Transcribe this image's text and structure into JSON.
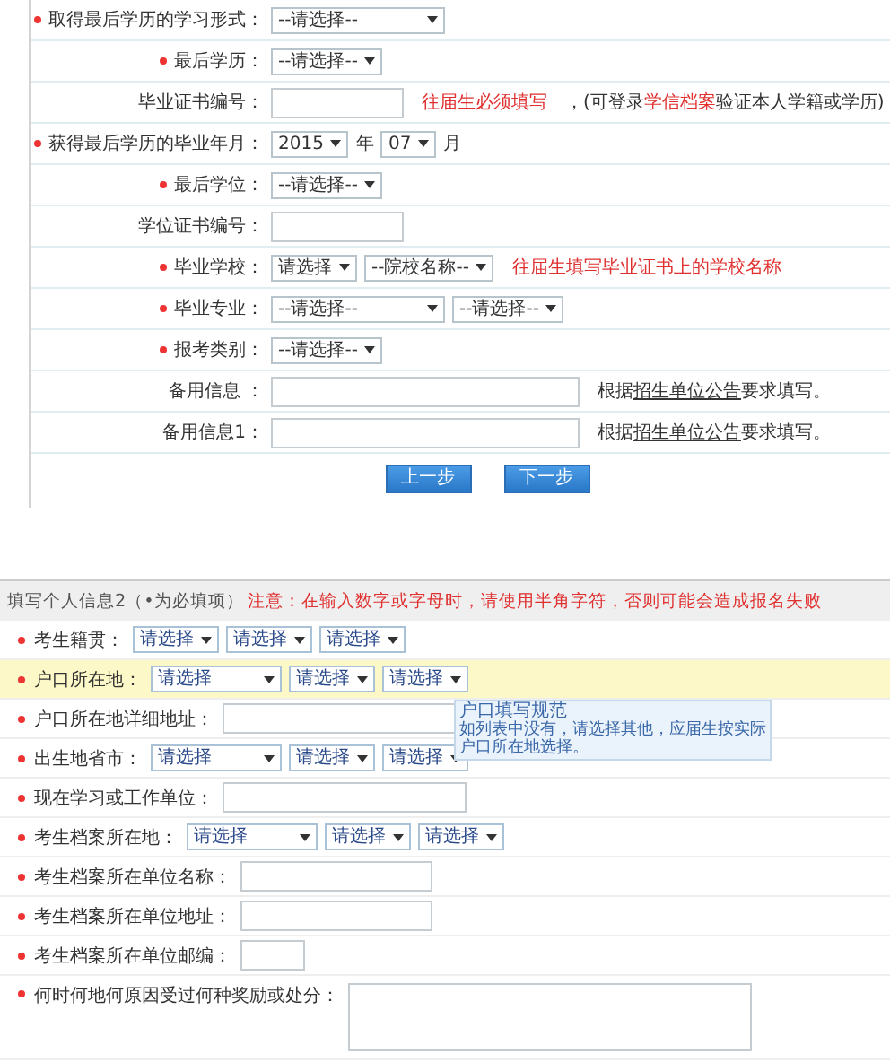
{
  "education_form": {
    "rows": [
      {
        "required": true,
        "label": "取得最后学历的学习形式：",
        "controls": [
          {
            "kind": "wide-select",
            "value": "--请选择--"
          }
        ]
      },
      {
        "required": true,
        "label": "最后学历：",
        "controls": [
          {
            "kind": "select",
            "value": "--请选择--"
          }
        ]
      },
      {
        "required": false,
        "label": "毕业证书编号：",
        "controls": [
          {
            "kind": "field"
          }
        ],
        "warning": "往届生必须填写",
        "hint": {
          "before": "，(可登录",
          "link": "学信档案",
          "after": "验证本人学籍或学历)"
        }
      },
      {
        "required": true,
        "label": "获得最后学历的毕业年月：",
        "controls": [
          {
            "kind": "short-select",
            "value": "2015"
          },
          {
            "kind": "unit",
            "value": "年"
          },
          {
            "kind": "short-select",
            "value": "07"
          },
          {
            "kind": "unit",
            "value": "月"
          }
        ]
      },
      {
        "required": true,
        "label": "最后学位：",
        "controls": [
          {
            "kind": "select",
            "value": "--请选择--"
          }
        ]
      },
      {
        "required": false,
        "label": "学位证书编号：",
        "controls": [
          {
            "kind": "field"
          }
        ]
      },
      {
        "required": true,
        "label": "毕业学校：",
        "controls": [
          {
            "kind": "short-select",
            "value": "请选择"
          },
          {
            "kind": "select",
            "value": "--院校名称--"
          }
        ],
        "warning": "往届生填写毕业证书上的学校名称"
      },
      {
        "required": true,
        "label": "毕业专业：",
        "controls": [
          {
            "kind": "wide-select",
            "value": "--请选择--"
          },
          {
            "kind": "select",
            "value": "--请选择--"
          }
        ]
      },
      {
        "required": true,
        "label": "报考类别：",
        "controls": [
          {
            "kind": "select",
            "value": "--请选择--"
          }
        ]
      },
      {
        "required": false,
        "label": "备用信息 ：",
        "controls": [
          {
            "kind": "long-field"
          }
        ],
        "hint": {
          "before": "根据",
          "link": "招生单位公告",
          "after": "要求填写。"
        }
      },
      {
        "required": false,
        "label": "备用信息1：",
        "controls": [
          {
            "kind": "long-field"
          }
        ],
        "hint": {
          "before": "根据",
          "link": "招生单位公告",
          "after": "要求填写。"
        }
      }
    ],
    "buttons": [
      "上一步",
      "下一步"
    ]
  },
  "personal_form": {
    "header": {
      "title": "填写个人信息2（•为必填项）",
      "notice": "注意：在输入数字或字母时，请使用半角字符，否则可能会造成报名失败"
    },
    "rows": [
      {
        "required": true,
        "highlighted": false,
        "label": "考生籍贯：",
        "controls": [
          {
            "kind": "select",
            "value": "请选择"
          },
          {
            "kind": "select",
            "value": "请选择"
          },
          {
            "kind": "select",
            "value": "请选择"
          }
        ]
      },
      {
        "required": true,
        "highlighted": true,
        "label": "户口所在地：",
        "controls": [
          {
            "kind": "wide-select",
            "value": "请选择"
          },
          {
            "kind": "select",
            "value": "请选择"
          },
          {
            "kind": "select",
            "value": "请选择"
          }
        ]
      },
      {
        "required": true,
        "highlighted": false,
        "label": "户口所在地详细地址：",
        "controls": [
          {
            "kind": "long-field"
          }
        ]
      },
      {
        "required": true,
        "highlighted": false,
        "label": "出生地省市：",
        "controls": [
          {
            "kind": "wide-select",
            "value": "请选择"
          },
          {
            "kind": "select",
            "value": "请选择"
          },
          {
            "kind": "select",
            "value": "请选择"
          }
        ]
      },
      {
        "required": true,
        "highlighted": false,
        "label": "现在学习或工作单位：",
        "controls": [
          {
            "kind": "long-field"
          }
        ]
      },
      {
        "required": true,
        "highlighted": false,
        "label": "考生档案所在地：",
        "controls": [
          {
            "kind": "wide-select",
            "value": "请选择"
          },
          {
            "kind": "select",
            "value": "请选择"
          },
          {
            "kind": "select",
            "value": "请选择"
          }
        ]
      },
      {
        "required": true,
        "highlighted": false,
        "label": "考生档案所在单位名称：",
        "controls": [
          {
            "kind": "field"
          }
        ]
      },
      {
        "required": true,
        "highlighted": false,
        "label": "考生档案所在单位地址：",
        "controls": [
          {
            "kind": "field"
          }
        ]
      },
      {
        "required": true,
        "highlighted": false,
        "label": "考生档案所在单位邮编：",
        "controls": [
          {
            "kind": "short-field"
          }
        ]
      },
      {
        "required": true,
        "highlighted": false,
        "label": "何时何地何原因受过何种奖励或处分：",
        "controls": [
          {
            "kind": "text-area"
          }
        ]
      }
    ],
    "tooltip": {
      "title": "户口填写规范",
      "body": "如列表中没有，请选择其他，应届生按实际户口所在地选择。"
    }
  }
}
